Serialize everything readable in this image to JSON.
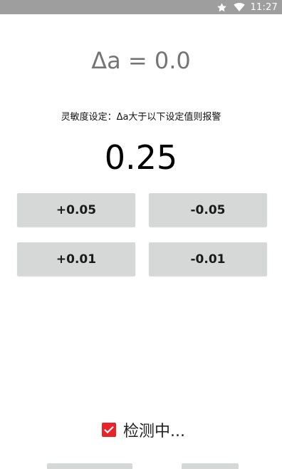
{
  "status_bar": {
    "time": "11:27",
    "icons": [
      "star-icon",
      "wifi-icon"
    ]
  },
  "delta_readout": "Δa = 0.0",
  "sensitivity_hint": "灵敏度设定：Δa大于以下设定值则报警",
  "threshold_value": "0.25",
  "buttons": {
    "plus_005": "+0.05",
    "minus_005": "-0.05",
    "plus_001": "+0.01",
    "minus_001": "-0.01"
  },
  "detection": {
    "label": "检测中...",
    "checked": true,
    "color": "#e8232a"
  },
  "colors": {
    "status_bar": "#9e9e9e",
    "button_bg": "#d6d7d7",
    "delta_text": "#757575"
  }
}
